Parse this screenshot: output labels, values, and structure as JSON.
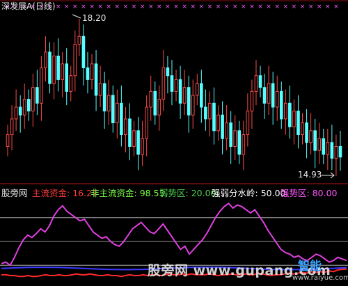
{
  "window": {
    "title": "深发展A(日线)"
  },
  "price_chart": {
    "high_label": "18.20",
    "low_label": "14.93",
    "colors": {
      "up": "#ff4a4a",
      "down": "#54ffff",
      "marker": "#ff60ff",
      "text": "#e6e6e6"
    }
  },
  "indicator": {
    "name": "股旁网",
    "items": [
      {
        "label": "主流资金:",
        "value": "16.27",
        "color": "#ff3b3b"
      },
      {
        "label": "非主流资金:",
        "value": "98.53",
        "color": "#7cff4a"
      },
      {
        "label": "弱势区:",
        "value": "20.00",
        "color": "#4dd04d"
      },
      {
        "label": "强弱分水岭:",
        "value": "50.00",
        "color": "#ffffff"
      },
      {
        "label": "强势区:",
        "value": "80.00",
        "color": "#ff55ff"
      }
    ],
    "colors": {
      "main": "#ff2a2a",
      "non_main": "#e040e0",
      "base": "#3a3aff",
      "level": "#c8c8c8"
    }
  },
  "watermarks": {
    "site_text": "股旁网 www.gupang.com",
    "logo_text": "智能",
    "sub_text": "www.raiyue.com"
  },
  "chart_data": [
    {
      "type": "candlestick",
      "title": "深发展A(日线)",
      "annotations": [
        "18.20",
        "14.93"
      ],
      "series": [
        {
          "name": "close",
          "values": [
            15.5,
            15.9,
            16.2,
            16.0,
            16.4,
            16.1,
            16.7,
            16.3,
            17.2,
            17.6,
            16.8,
            17.5,
            16.9,
            17.3,
            16.6,
            17.0,
            17.8,
            18.0,
            17.2,
            16.9,
            17.3,
            16.5,
            16.8,
            16.1,
            16.5,
            15.8,
            16.3,
            15.5,
            15.9,
            15.2,
            15.6,
            15.0,
            15.4,
            16.2,
            16.6,
            16.0,
            16.4,
            17.2,
            17.0,
            16.6,
            16.9,
            16.3,
            16.7,
            16.0,
            16.5,
            16.8,
            16.2,
            15.9,
            16.3,
            15.6,
            16.0,
            15.4,
            15.8,
            15.2,
            15.6,
            15.0,
            15.5,
            16.1,
            16.6,
            17.0,
            16.7,
            16.3,
            16.8,
            16.2,
            16.6,
            15.9,
            16.3,
            15.7,
            16.1,
            15.5,
            15.8,
            15.3,
            15.6,
            15.1,
            15.4,
            15.0,
            15.3,
            14.9,
            15.2,
            14.93
          ]
        }
      ]
    },
    {
      "type": "line",
      "ylim": [
        0,
        100
      ],
      "series": [
        {
          "name": "主流资金",
          "values": [
            8,
            8,
            7,
            7,
            6,
            6,
            7,
            6,
            6,
            7,
            8,
            7,
            7,
            8,
            7,
            7,
            8,
            9,
            8,
            8,
            9,
            8,
            7,
            7,
            8,
            7,
            7,
            6,
            7,
            8,
            7,
            7,
            8,
            7,
            8,
            8,
            7,
            8,
            9,
            8,
            8,
            9,
            8,
            9,
            8,
            8,
            8,
            9,
            8,
            7,
            8,
            8,
            9,
            8,
            8,
            9,
            8,
            8,
            10,
            9,
            8,
            7,
            8,
            8,
            9,
            10,
            9,
            10,
            11,
            10,
            12,
            11,
            12,
            11,
            13,
            12,
            14,
            15,
            15,
            16.27
          ]
        },
        {
          "name": "非主流资金",
          "values": [
            22,
            24,
            20,
            30,
            42,
            52,
            58,
            55,
            60,
            66,
            62,
            70,
            82,
            90,
            95,
            88,
            84,
            80,
            76,
            78,
            70,
            62,
            58,
            54,
            56,
            50,
            46,
            44,
            50,
            58,
            66,
            70,
            74,
            68,
            62,
            60,
            66,
            72,
            64,
            56,
            48,
            40,
            44,
            34,
            40,
            46,
            52,
            60,
            70,
            80,
            88,
            94,
            98,
            92,
            96,
            94,
            90,
            86,
            90,
            82,
            74,
            64,
            56,
            48,
            40,
            36,
            34,
            30,
            32,
            28,
            26,
            30,
            34,
            32,
            28,
            24,
            26,
            30,
            28,
            26,
            98.53
          ]
        },
        {
          "name": "弱势区",
          "values": [
            20
          ]
        },
        {
          "name": "强弱分水岭",
          "values": [
            50
          ]
        },
        {
          "name": "强势区",
          "values": [
            80
          ]
        }
      ]
    }
  ]
}
